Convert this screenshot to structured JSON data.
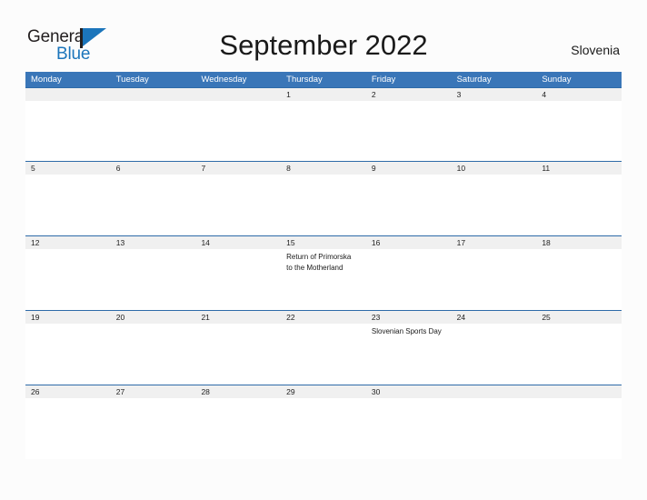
{
  "brand": {
    "name_part1": "General",
    "name_part2": "Blue",
    "flag_icon": "blue-flag-triangle-icon",
    "accent_color": "#1b75bb",
    "dark_color": "#231f20"
  },
  "header": {
    "title": "September 2022",
    "region": "Slovenia"
  },
  "theme": {
    "header_blue": "#3a76b8",
    "band_gray": "#f0f0f0",
    "page_background": "#fcfcfc",
    "separator_blue": "#2e6ba8"
  },
  "calendar": {
    "month": "September",
    "year": "2022",
    "weekday_headers": [
      "Monday",
      "Tuesday",
      "Wednesday",
      "Thursday",
      "Friday",
      "Saturday",
      "Sunday"
    ],
    "weeks": [
      {
        "days": [
          {
            "date": "",
            "event": ""
          },
          {
            "date": "",
            "event": ""
          },
          {
            "date": "",
            "event": ""
          },
          {
            "date": "1",
            "event": ""
          },
          {
            "date": "2",
            "event": ""
          },
          {
            "date": "3",
            "event": ""
          },
          {
            "date": "4",
            "event": ""
          }
        ]
      },
      {
        "days": [
          {
            "date": "5",
            "event": ""
          },
          {
            "date": "6",
            "event": ""
          },
          {
            "date": "7",
            "event": ""
          },
          {
            "date": "8",
            "event": ""
          },
          {
            "date": "9",
            "event": ""
          },
          {
            "date": "10",
            "event": ""
          },
          {
            "date": "11",
            "event": ""
          }
        ]
      },
      {
        "days": [
          {
            "date": "12",
            "event": ""
          },
          {
            "date": "13",
            "event": ""
          },
          {
            "date": "14",
            "event": ""
          },
          {
            "date": "15",
            "event": "Return of Primorska to the Motherland"
          },
          {
            "date": "16",
            "event": ""
          },
          {
            "date": "17",
            "event": ""
          },
          {
            "date": "18",
            "event": ""
          }
        ]
      },
      {
        "days": [
          {
            "date": "19",
            "event": ""
          },
          {
            "date": "20",
            "event": ""
          },
          {
            "date": "21",
            "event": ""
          },
          {
            "date": "22",
            "event": ""
          },
          {
            "date": "23",
            "event": "Slovenian Sports Day"
          },
          {
            "date": "24",
            "event": ""
          },
          {
            "date": "25",
            "event": ""
          }
        ]
      },
      {
        "days": [
          {
            "date": "26",
            "event": ""
          },
          {
            "date": "27",
            "event": ""
          },
          {
            "date": "28",
            "event": ""
          },
          {
            "date": "29",
            "event": ""
          },
          {
            "date": "30",
            "event": ""
          },
          {
            "date": "",
            "event": ""
          },
          {
            "date": "",
            "event": ""
          }
        ]
      }
    ]
  }
}
